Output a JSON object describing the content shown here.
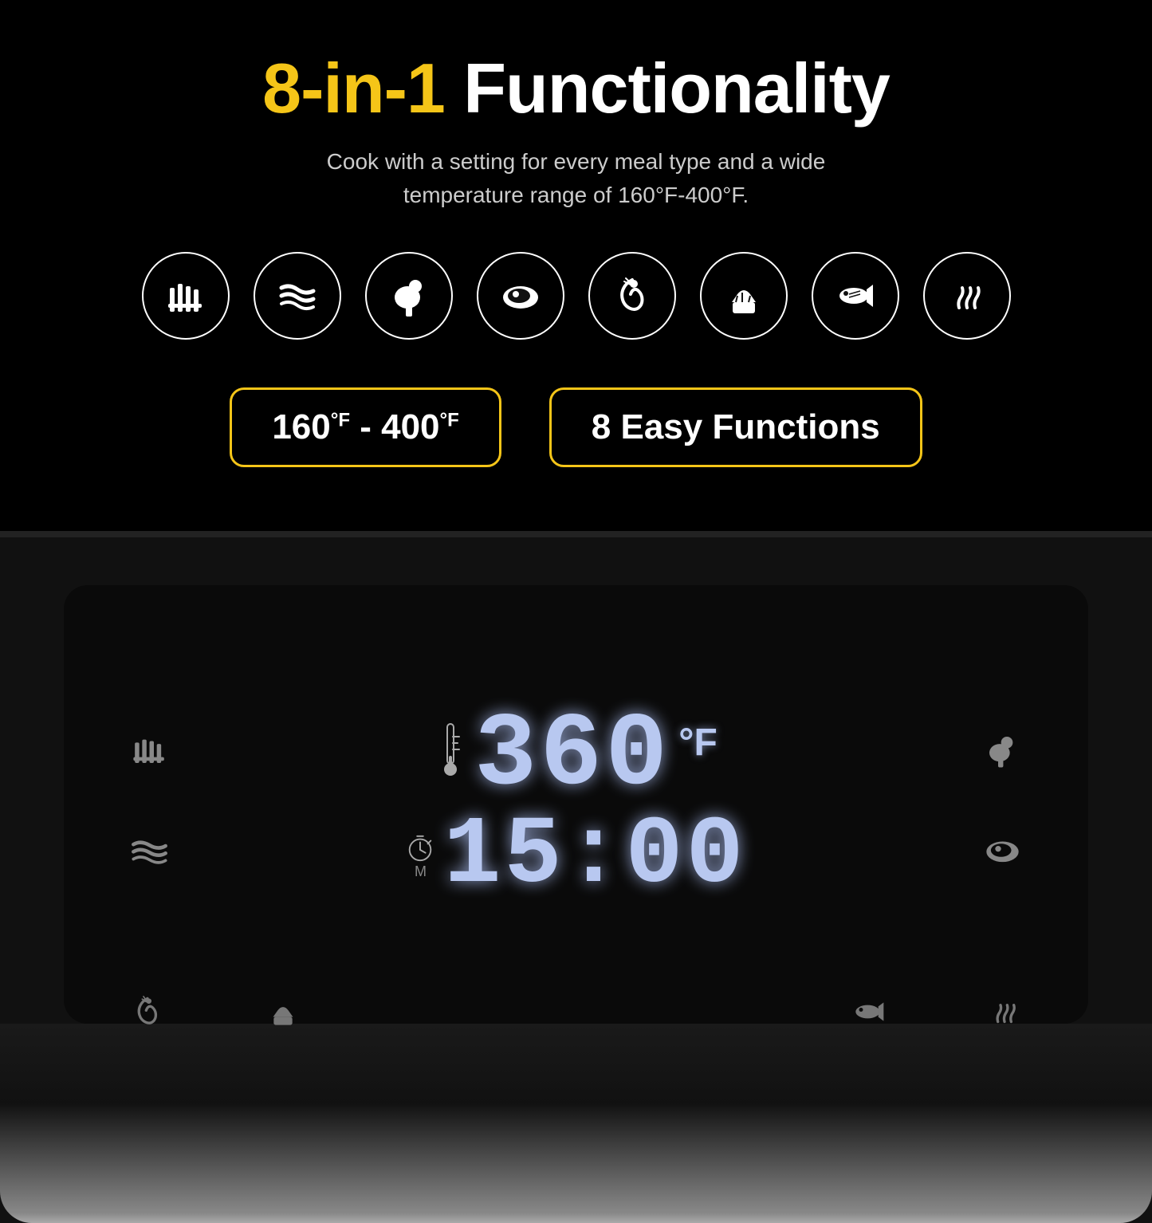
{
  "page": {
    "title_highlight": "8-in-1",
    "title_rest": " Functionality",
    "subtitle": "Cook with a setting for every meal type and a wide temperature range of 160°F-400°F.",
    "icons": [
      {
        "id": "fries",
        "symbol": "🍟",
        "label": "Fries"
      },
      {
        "id": "bacon",
        "symbol": "🥓",
        "label": "Bacon"
      },
      {
        "id": "chicken",
        "symbol": "🍗",
        "label": "Chicken"
      },
      {
        "id": "steak",
        "symbol": "🥩",
        "label": "Steak"
      },
      {
        "id": "shrimp",
        "symbol": "🍤",
        "label": "Shrimp"
      },
      {
        "id": "muffin",
        "symbol": "🧁",
        "label": "Muffin"
      },
      {
        "id": "fish",
        "symbol": "🐟",
        "label": "Fish"
      },
      {
        "id": "steam",
        "symbol": "♨",
        "label": "Steam"
      }
    ],
    "badge_temp": {
      "label": "160°F - 400°F",
      "temp_low": "160",
      "temp_high": "400",
      "unit": "°F"
    },
    "badge_functions": {
      "label": "8 Easy Functions",
      "number": "8",
      "text": "Easy Functions"
    },
    "control_panel": {
      "temperature": "360",
      "temp_unit": "°F",
      "timer": "15:00",
      "left_icons_top": [
        "🍟",
        "🥓"
      ],
      "left_icons_bottom": [
        "🍤",
        "🧁"
      ],
      "right_icons_top": [
        "🍗",
        "🥩"
      ],
      "right_icons_bottom": [
        "🐟",
        "♨"
      ],
      "bottom_left": {
        "plus": "+",
        "clock": "⏱",
        "minus": "−"
      },
      "bottom_right": {
        "minus": "−",
        "thermometer": "🌡",
        "plus": "+"
      }
    },
    "colors": {
      "highlight_yellow": "#f5c518",
      "display_blue": "#b8c8f0",
      "border_yellow": "#f5c518",
      "background": "#000000",
      "panel_bg": "#0a0a0a",
      "icon_color": "#999999"
    }
  }
}
